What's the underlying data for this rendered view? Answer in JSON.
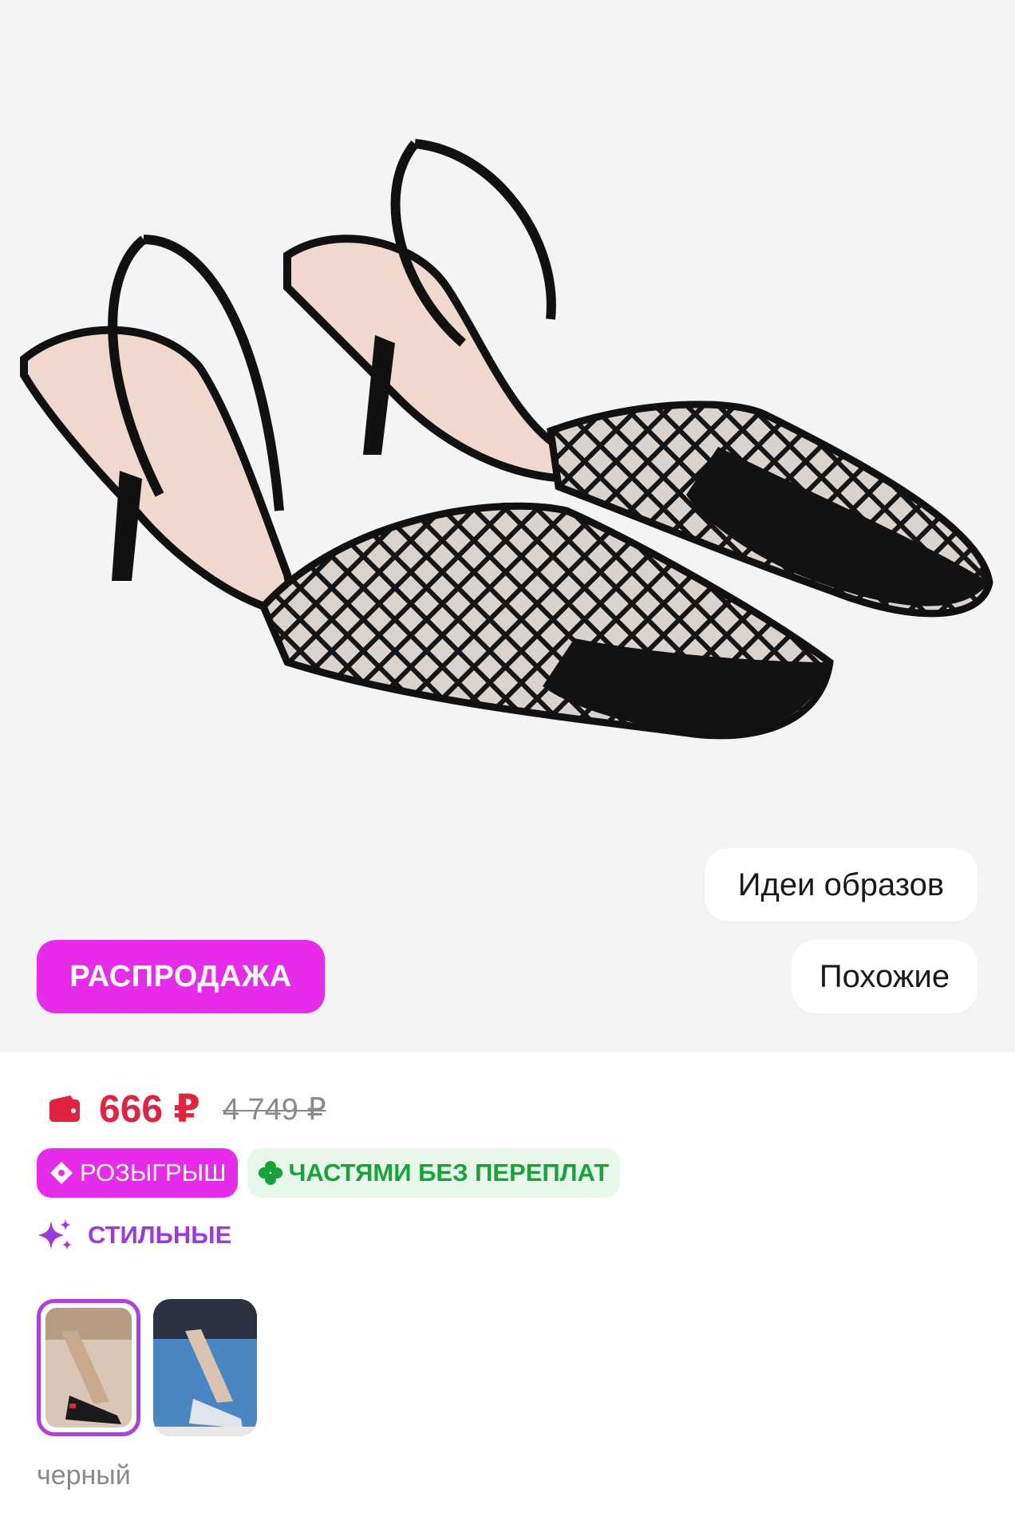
{
  "hero": {
    "image_alt": "black mesh slingback kitten heel pumps",
    "ideas_label": "Идеи образов",
    "similar_label": "Похожие",
    "sale_badge": "РАСПРОДАЖА"
  },
  "price": {
    "current": "666 ₽",
    "old": "4 749 ₽",
    "wallet_icon": "wallet-icon",
    "price_color": "#e0233f"
  },
  "badges": {
    "raffle_label": "РОЗЫГРЫШ",
    "raffle_icon": "ticket-icon",
    "installments_label": "ЧАСТЯМИ БЕЗ ПЕРЕПЛАТ",
    "installments_icon": "clover-icon",
    "stylish_label": "СТИЛЬНЫЕ",
    "stylish_icon": "sparkles-icon"
  },
  "colors": {
    "accent_pink": "#e62ce8",
    "accent_purple": "#9b3ae0",
    "green": "#18a33a",
    "variants": [
      {
        "name": "черный",
        "selected": true
      },
      {
        "name": "",
        "selected": false
      }
    ],
    "selected_name": "черный"
  }
}
